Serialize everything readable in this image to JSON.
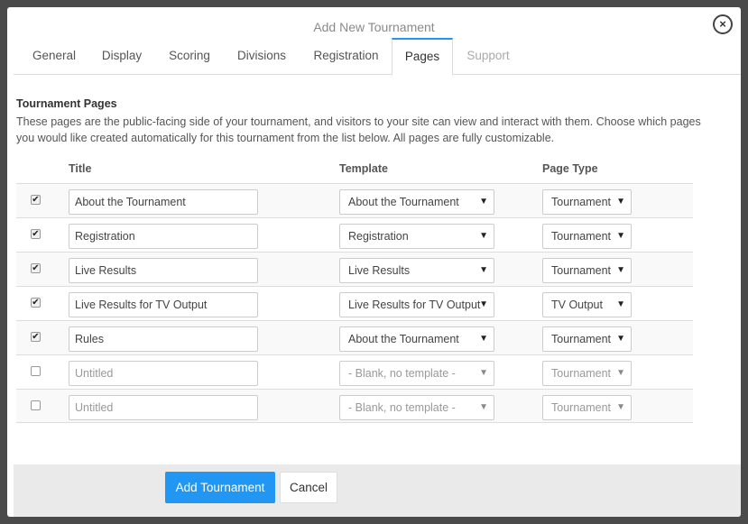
{
  "modal": {
    "title": "Add New Tournament",
    "close_symbol": "×"
  },
  "tabs": [
    {
      "label": "General",
      "state": "normal"
    },
    {
      "label": "Display",
      "state": "normal"
    },
    {
      "label": "Scoring",
      "state": "normal"
    },
    {
      "label": "Divisions",
      "state": "normal"
    },
    {
      "label": "Registration",
      "state": "normal"
    },
    {
      "label": "Pages",
      "state": "active"
    },
    {
      "label": "Support",
      "state": "disabled"
    }
  ],
  "section": {
    "title": "Tournament Pages",
    "description": "These pages are the public-facing side of your tournament, and visitors to your site can view and interact with them. Choose which pages you would like created automatically for this tournament from the list below. All pages are fully customizable."
  },
  "table": {
    "headers": {
      "title": "Title",
      "template": "Template",
      "page_type": "Page Type"
    },
    "rows": [
      {
        "checked": true,
        "title": "About the Tournament",
        "is_placeholder": false,
        "template": "About the Tournament",
        "page_type": "Tournament"
      },
      {
        "checked": true,
        "title": "Registration",
        "is_placeholder": false,
        "template": "Registration",
        "page_type": "Tournament"
      },
      {
        "checked": true,
        "title": "Live Results",
        "is_placeholder": false,
        "template": "Live Results",
        "page_type": "Tournament"
      },
      {
        "checked": true,
        "title": "Live Results for TV Output",
        "is_placeholder": false,
        "template": "Live Results for TV Output",
        "page_type": "TV Output"
      },
      {
        "checked": true,
        "title": "Rules",
        "is_placeholder": false,
        "template": "About the Tournament",
        "page_type": "Tournament"
      },
      {
        "checked": false,
        "title": "Untitled",
        "is_placeholder": true,
        "template": "- Blank, no template -",
        "page_type": "Tournament"
      },
      {
        "checked": false,
        "title": "Untitled",
        "is_placeholder": true,
        "template": "- Blank, no template -",
        "page_type": "Tournament"
      }
    ]
  },
  "footer": {
    "primary_label": "Add Tournament",
    "cancel_label": "Cancel"
  },
  "colors": {
    "accent": "#2196f3",
    "footer_bg": "#eaeaea"
  },
  "icons": {
    "checkbox_checked": "check-icon",
    "select_arrow": "caret-down-icon",
    "close": "close-icon"
  }
}
